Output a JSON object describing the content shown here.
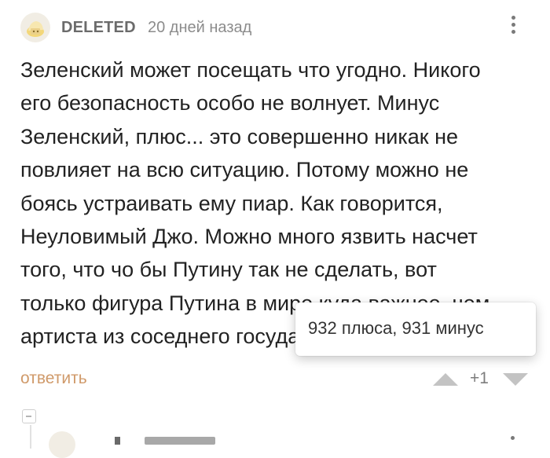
{
  "comment": {
    "author": "DELETED",
    "time": "20 дней назад",
    "text_lines": [
      "Зеленский может посещать что угодно. Никого",
      "его безопасность особо не волнует. Минус",
      "Зеленский, плюс... это совершенно никак не",
      "повлияет на всю ситуацию. Потому можно не",
      "боясь устраивать ему пиар. Как говорится,",
      "Неуловимый Джо. Можно много язвить насчет",
      "того, что чо бы Путину так не сделать, вот",
      "только фигура Путина в мире куда важнее, чем",
      "артиста из соседнего государства."
    ],
    "reply_label": "ответить",
    "rating": "+1",
    "tooltip": "932 плюса, 931 минус"
  },
  "icons": {
    "avatar": "deleted-user-avatar-icon",
    "menu": "more-vertical-icon",
    "vote_up": "triangle-up-icon",
    "vote_down": "triangle-down-icon",
    "collapse": "collapse-thread-icon"
  },
  "colors": {
    "text": "#222222",
    "author": "#6b6b6b",
    "meta": "#8c8c8c",
    "reply_link": "#d09a6a",
    "vote_arrows": "#c3c3c3"
  }
}
